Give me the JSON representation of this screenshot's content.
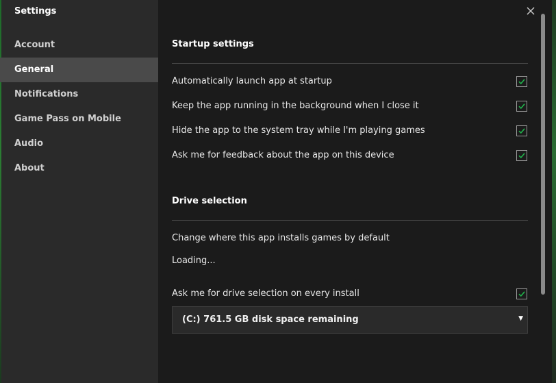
{
  "sidebar": {
    "title": "Settings",
    "items": [
      {
        "label": "Account"
      },
      {
        "label": "General"
      },
      {
        "label": "Notifications"
      },
      {
        "label": "Game Pass on Mobile"
      },
      {
        "label": "Audio"
      },
      {
        "label": "About"
      }
    ],
    "active": "General"
  },
  "startup": {
    "title": "Startup settings",
    "options": [
      {
        "label": "Automatically launch app at startup",
        "checked": true
      },
      {
        "label": "Keep the app running in the background when I close it",
        "checked": true
      },
      {
        "label": "Hide the app to the system tray while I'm playing games",
        "checked": true
      },
      {
        "label": "Ask me for feedback about the app on this device",
        "checked": true
      }
    ]
  },
  "drive": {
    "title": "Drive selection",
    "change_label": "Change where this app installs games by default",
    "loading_label": "Loading...",
    "ask_label": "Ask me for drive selection on every install",
    "ask_checked": true,
    "selected_drive": "(C:) 761.5 GB disk space remaining"
  },
  "colors": {
    "check": "#21b24b",
    "accent_edge": "#2b7d33"
  },
  "icons": {
    "close": "close-icon",
    "check": "checkmark-icon",
    "dropdown": "chevron-down-icon"
  }
}
